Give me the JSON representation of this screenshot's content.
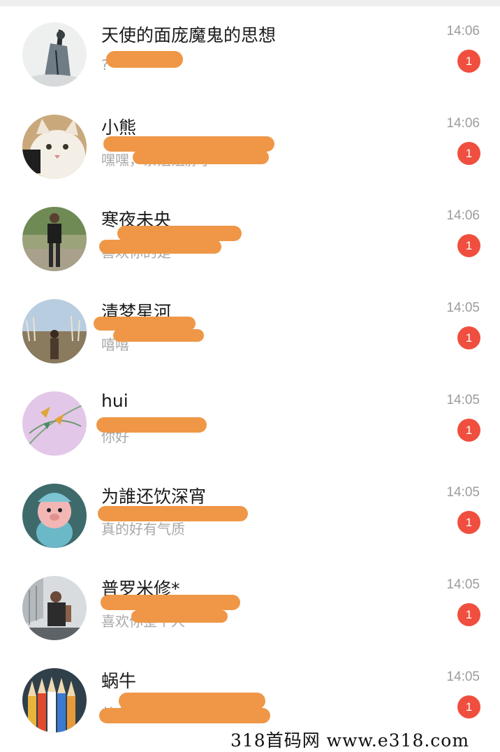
{
  "colors": {
    "badge": "#f04e3e",
    "redaction": "#ef9747"
  },
  "conversations": [
    {
      "name": "天使的面庞魔鬼的思想",
      "preview": "?",
      "time": "14:06",
      "unread": "1",
      "avatar": "ink-painting-figure"
    },
    {
      "name": "小熊",
      "preview": "嘿嘿，亲姐姐脖子",
      "time": "14:06",
      "unread": "1",
      "avatar": "white-cat"
    },
    {
      "name": "寒夜未央",
      "preview": "喜欢你的是",
      "time": "14:06",
      "unread": "1",
      "avatar": "man-standing"
    },
    {
      "name": "清梦星河",
      "preview": "嘻嘻",
      "time": "14:05",
      "unread": "1",
      "avatar": "woman-in-reeds"
    },
    {
      "name": "hui",
      "preview": "你好",
      "time": "14:05",
      "unread": "1",
      "avatar": "pink-flower-painting"
    },
    {
      "name": "为誰还饮深宵",
      "preview": "真的好有气质",
      "time": "14:05",
      "unread": "1",
      "avatar": "cartoon-pig"
    },
    {
      "name": "普罗米修*",
      "preview": "喜欢你整个人",
      "time": "14:05",
      "unread": "1",
      "avatar": "athletic-man"
    },
    {
      "name": "蜗牛",
      "preview": "美女好人",
      "time": "14:05",
      "unread": "1",
      "avatar": "colored-pencils"
    }
  ],
  "watermark": "318首码网  www.e318.com"
}
